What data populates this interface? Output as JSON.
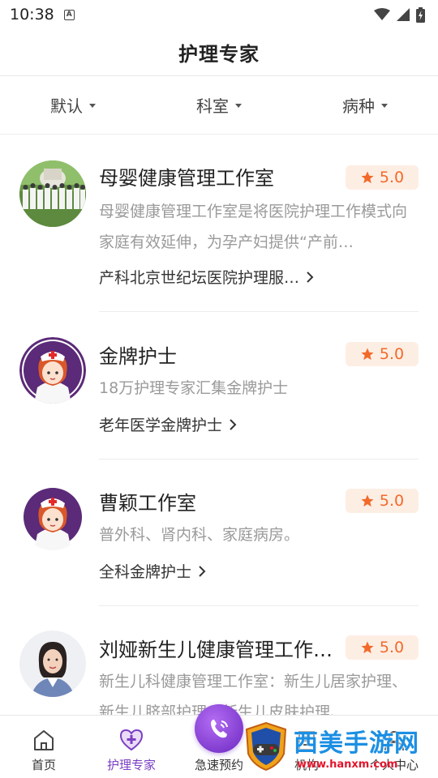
{
  "status": {
    "time": "10:38",
    "notif_glyph": "A"
  },
  "header": {
    "title": "护理专家"
  },
  "filters": [
    {
      "label": "默认"
    },
    {
      "label": "科室"
    },
    {
      "label": "病种"
    }
  ],
  "experts": [
    {
      "name": "母婴健康管理工作室",
      "rating": "5.0",
      "description": "母婴健康管理工作室是将医院护理工作模式向家庭有效延伸，为孕产妇提供“产前…",
      "tag": "产科北京世纪坛医院护理服…",
      "avatar": "group-photo"
    },
    {
      "name": "金牌护士",
      "rating": "5.0",
      "description": "18万护理专家汇集金牌护士",
      "tag": "老年医学金牌护士",
      "avatar": "nurse-illustration"
    },
    {
      "name": "曹颖工作室",
      "rating": "5.0",
      "description": "普外科、肾内科、家庭病房。",
      "tag": "全科金牌护士",
      "avatar": "nurse-illustration"
    },
    {
      "name": "刘娅新生儿健康管理工作…",
      "rating": "5.0",
      "description": "新生儿科健康管理工作室：新生儿居家护理、新生儿脐部护理、新生儿皮肤护理、…",
      "tag": "",
      "avatar": "woman-photo"
    }
  ],
  "tabbar": {
    "items": [
      {
        "label": "首页",
        "icon": "home-icon"
      },
      {
        "label": "护理专家",
        "icon": "heart-plus-icon"
      },
      {
        "label": "急速预约",
        "icon": "phone-icon"
      },
      {
        "label": "机构",
        "icon": "building-icon"
      },
      {
        "label": "个人中心",
        "icon": "person-icon"
      }
    ]
  },
  "watermark": {
    "title": "西美手游网",
    "url": "www.hanxm.com"
  },
  "colors": {
    "accent": "#7b3fc4",
    "rating": "#f26a2a",
    "rating_bg": "#fdeee4"
  }
}
